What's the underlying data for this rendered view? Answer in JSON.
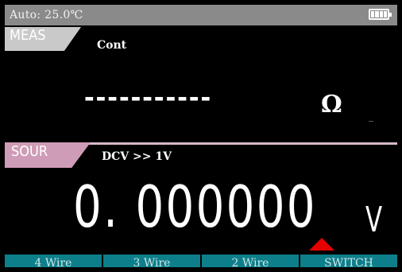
{
  "status": {
    "text": "Auto: 25.0℃",
    "battery_icon": "battery-full-icon"
  },
  "meas": {
    "tab_label": "MEAS",
    "mode": "Cont",
    "value": "-----------",
    "unit": "Ω"
  },
  "sour": {
    "tab_label": "SOUR",
    "range": "DCV >> 1V",
    "value": "0. 000000",
    "unit": "V",
    "cursor_icon": "cursor-up-arrow-icon"
  },
  "softkeys": [
    "4 Wire",
    "3 Wire",
    "2 Wire",
    "SWITCH"
  ],
  "colors": {
    "status_bar": "#8a8a8a",
    "meas_tab": "#c9c9c9",
    "sour_tab": "#cf9cb7",
    "softkey": "#0d7f8a",
    "cursor": "#e60000"
  }
}
